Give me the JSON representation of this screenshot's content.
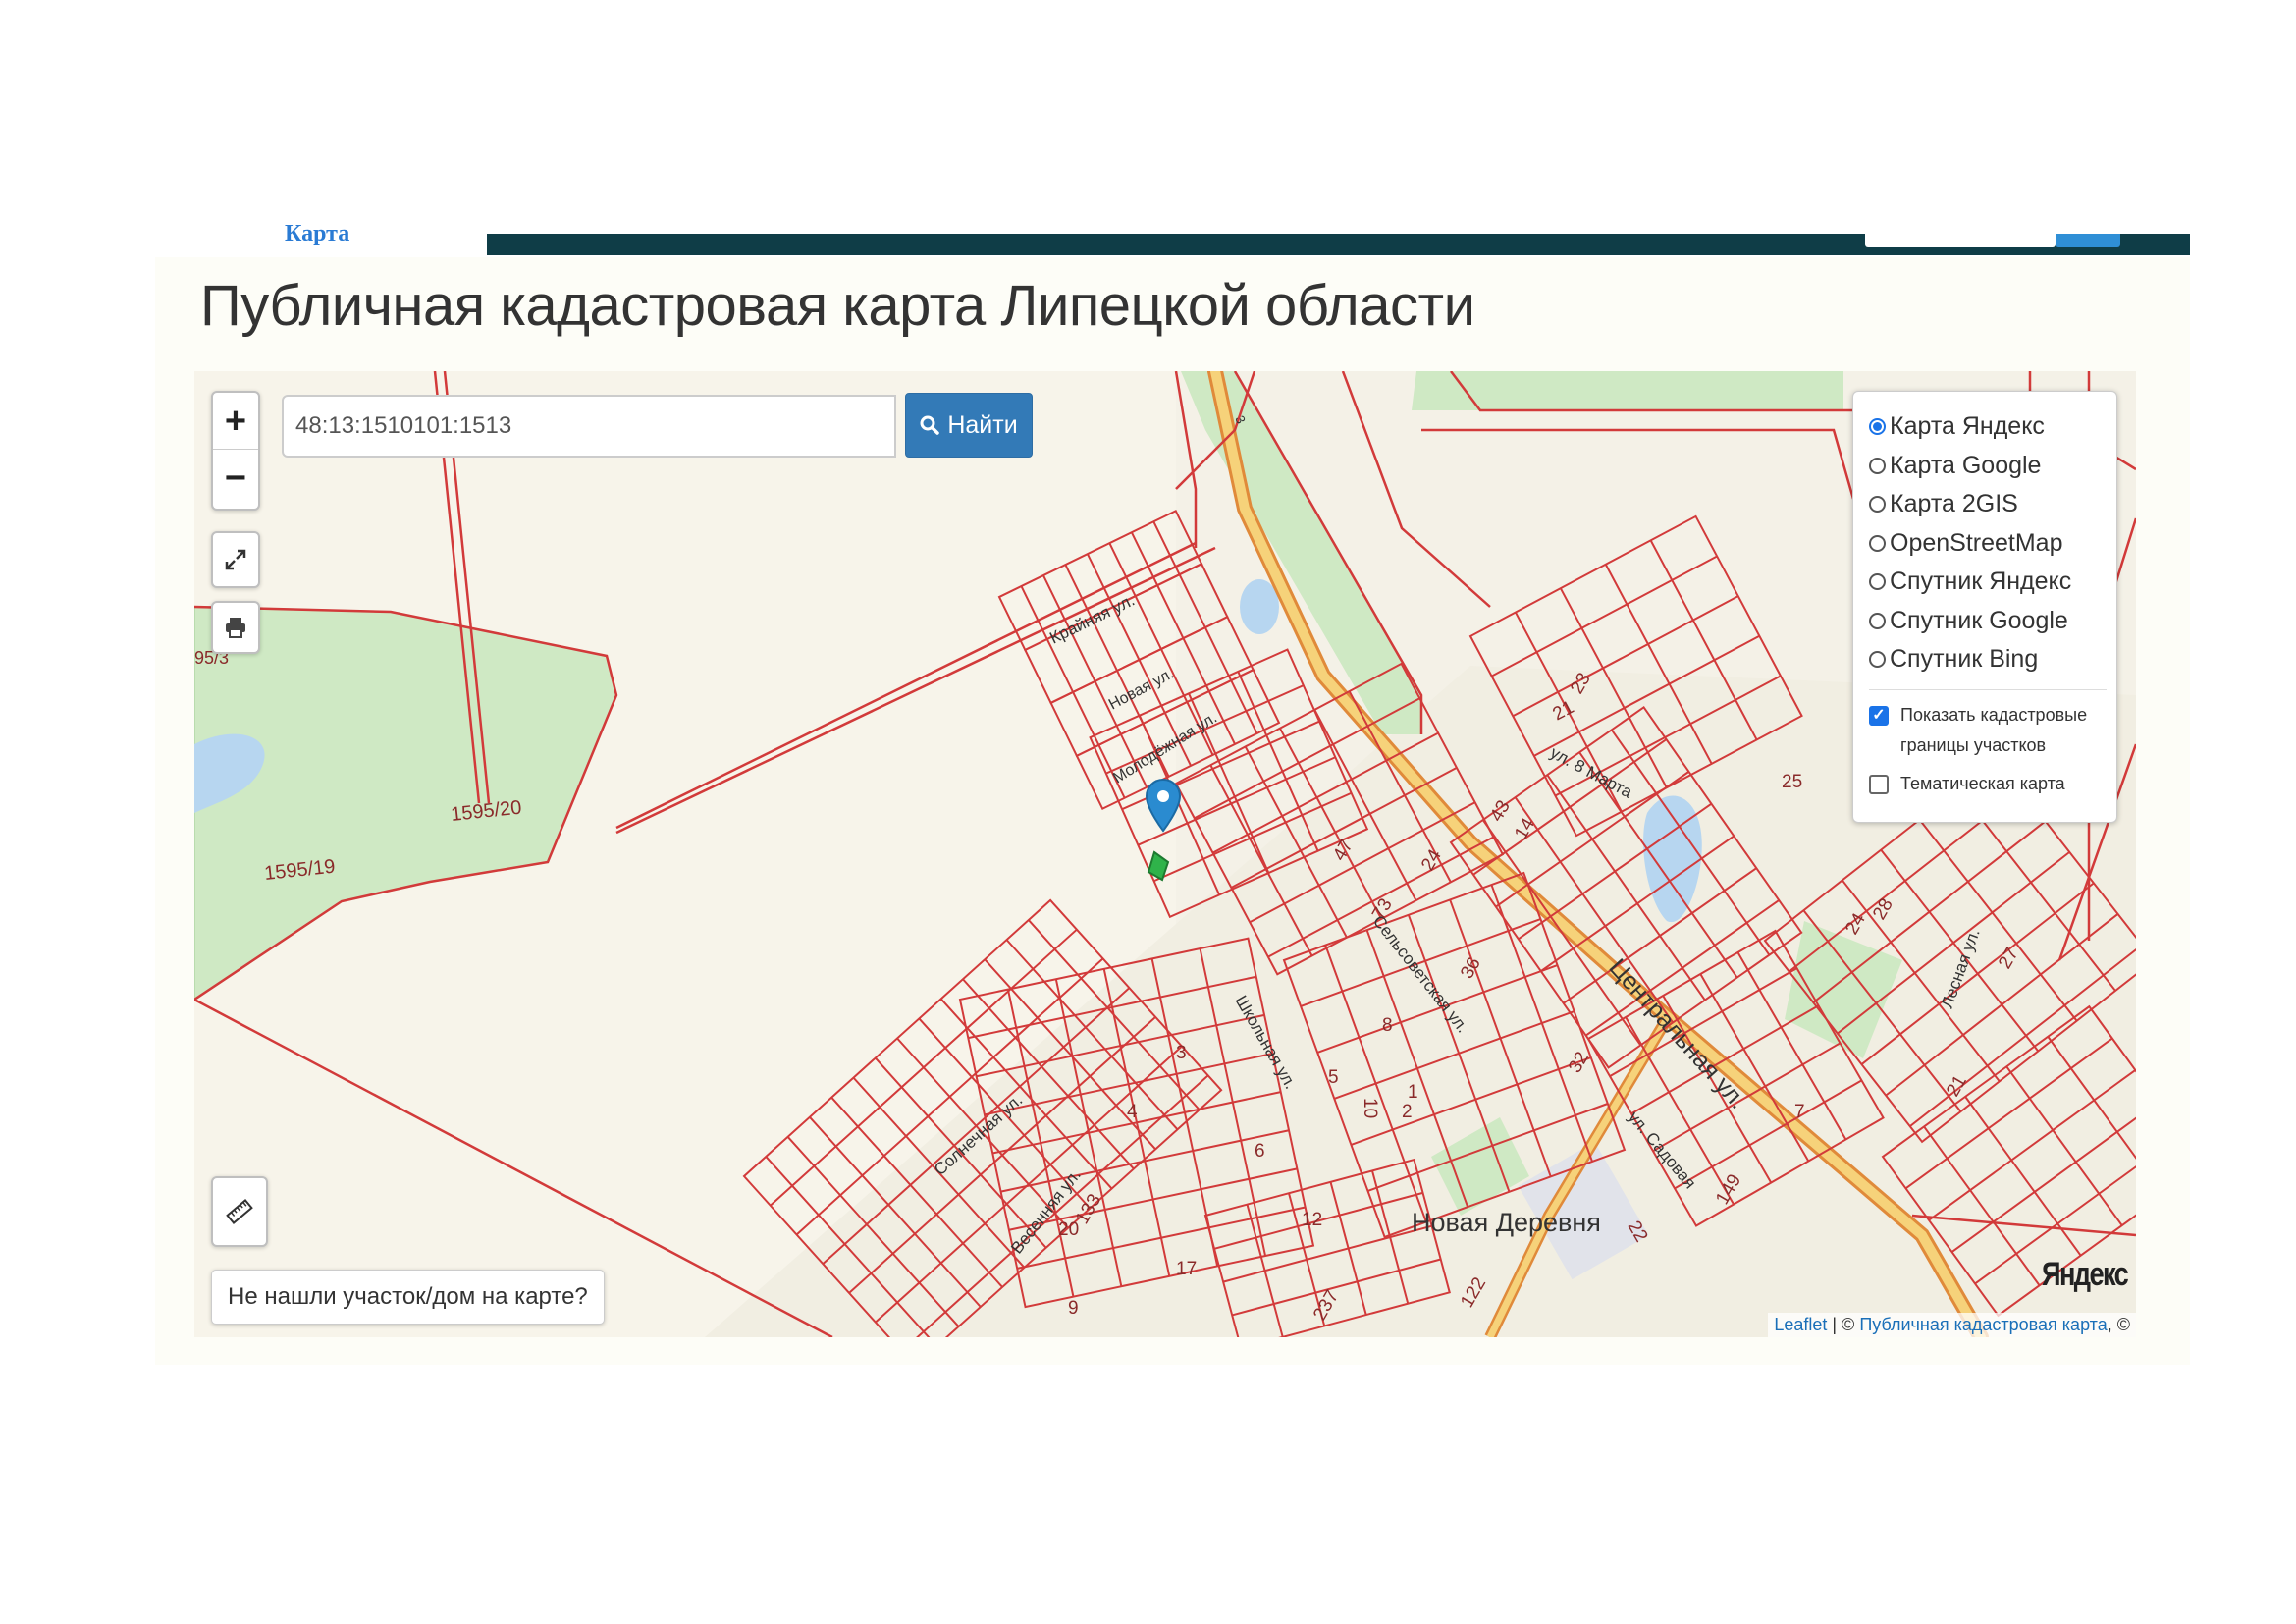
{
  "top": {
    "nav_label": "Карта"
  },
  "page": {
    "title": "Публичная кадастровая карта Липецкой области"
  },
  "map": {
    "zoom_in": "+",
    "zoom_out": "−",
    "search": {
      "value": "48:13:1510101:1513"
    },
    "search_button": "Найти",
    "not_found_button": "Не нашли участок/дом на карте?",
    "layers": [
      {
        "label": "Карта Яндекс",
        "selected": true
      },
      {
        "label": "Карта Google",
        "selected": false
      },
      {
        "label": "Карта 2GIS",
        "selected": false
      },
      {
        "label": "OpenStreetMap",
        "selected": false
      },
      {
        "label": "Спутник Яндекс",
        "selected": false
      },
      {
        "label": "Спутник Google",
        "selected": false
      },
      {
        "label": "Спутник Bing",
        "selected": false
      }
    ],
    "options": [
      {
        "label": "Показать кадастровые границы участков",
        "checked": true
      },
      {
        "label": "Тематическая карта",
        "checked": false
      }
    ],
    "labels": {
      "village": "Новая Деревня",
      "street_central": "Центральная ул.",
      "street_krainyaya": "Крайняя ул.",
      "street_solnechnaya": "Солнечная ул.",
      "street_shkolnaya": "Школьная ул.",
      "street_sovetskaya": "Сельсоветская ул.",
      "street_8marta": "ул. 8 Марта",
      "street_lesnaya": "Лесная ул.",
      "street_sadovaya": "ул. Садовая",
      "street_vesennyaya": "Весенняя ул.",
      "street_molodezhnaya": "Молодёжная ул.",
      "street_novaya": "Новая ул.",
      "parcel_1": "1595/20",
      "parcel_2": "1595/19",
      "parcel_3": "95/3",
      "nums": [
        "25",
        "21",
        "23",
        "43",
        "14",
        "24",
        "47",
        "73",
        "36",
        "32",
        "22",
        "122",
        "237",
        "133",
        "149",
        "28",
        "24",
        "27",
        "21",
        "8",
        "3",
        "10",
        "6",
        "2",
        "4",
        "5",
        "7",
        "12",
        "1",
        "17",
        "20",
        "9"
      ],
      "road_num": "3"
    },
    "yandex_logo": "Яндекс",
    "attribution": {
      "leaflet": "Leaflet",
      "sep": " | © ",
      "pkk": "Публичная кадастровая карта",
      "tail": ", ©"
    }
  },
  "colors": {
    "parcel": "#d23a3a",
    "forest": "#cfe9c4",
    "road": "#f5c86a",
    "water": "#b7d6f0",
    "button": "#337ab7",
    "topbar": "#0f3d47"
  }
}
